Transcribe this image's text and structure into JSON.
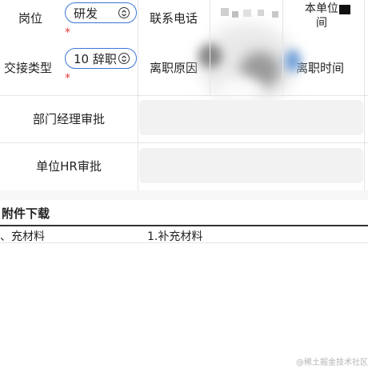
{
  "form": {
    "row1": {
      "post_label": "岗位",
      "post_value": "研发",
      "contact_label": "联系电话",
      "unit_time_label_line1": "本单位",
      "unit_time_label_line2": "间"
    },
    "row2": {
      "handover_label": "交接类型",
      "handover_value": "10 辞职",
      "reason_label": "离职原因",
      "time_label": "离职时间"
    },
    "required_mark": "*",
    "approvals": [
      {
        "label": "部门经理审批",
        "value": ""
      },
      {
        "label": "单位HR审批",
        "value": ""
      }
    ]
  },
  "attachments": {
    "title": "附件下载",
    "row_left": "、充材料",
    "row_right": "1.补充材料"
  },
  "watermark": "@稀土掘金技术社区",
  "colors": {
    "accent": "#3a76d6",
    "required": "#e53935",
    "field_bg": "#f2f2f2"
  }
}
